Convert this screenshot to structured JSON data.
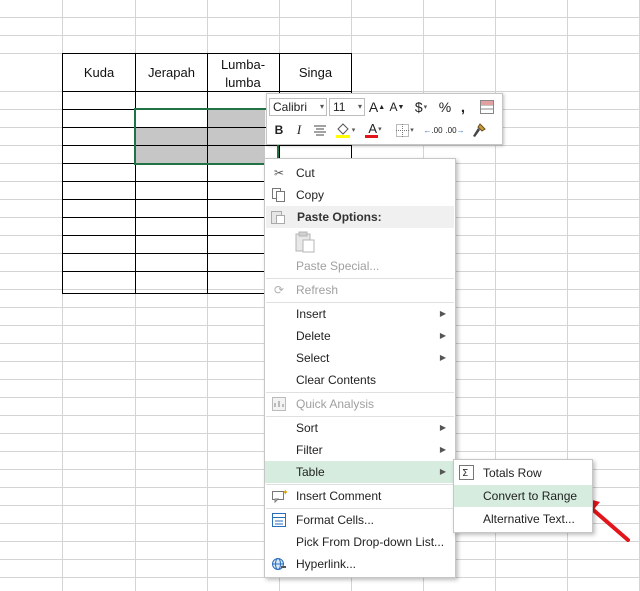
{
  "table_headers": [
    "Kuda",
    "Jerapah",
    "Lumba-\nlumba",
    "Singa"
  ],
  "mini_toolbar": {
    "font_name": "Calibri",
    "font_size": "11",
    "grow_font": "A",
    "shrink_font": "A",
    "currency": "$",
    "percent": "%",
    "comma": ",",
    "bold": "B",
    "italic": "I",
    "font_color": "A",
    "decrease_decimal": ".00",
    "increase_decimal": ".00"
  },
  "context_menu": {
    "cut": "Cut",
    "copy": "Copy",
    "paste_options": "Paste Options:",
    "paste_special": "Paste Special...",
    "refresh": "Refresh",
    "insert": "Insert",
    "delete": "Delete",
    "select": "Select",
    "clear_contents": "Clear Contents",
    "quick_analysis": "Quick Analysis",
    "sort": "Sort",
    "filter": "Filter",
    "table": "Table",
    "insert_comment": "Insert Comment",
    "format_cells": "Format Cells...",
    "pick_from_list": "Pick From Drop-down List...",
    "hyperlink": "Hyperlink..."
  },
  "table_submenu": {
    "totals_row": "Totals Row",
    "convert_to_range": "Convert to Range",
    "alternative_text": "Alternative Text..."
  },
  "colors": {
    "gridline": "#d4d4d4",
    "selection_border": "#217346",
    "selected_fill": "#c6c6c6",
    "menu_highlight": "#d5ecdf",
    "arrow": "#e3151b",
    "font_color_bar": "#e3151b",
    "fill_color_bar": "#ffff00"
  }
}
